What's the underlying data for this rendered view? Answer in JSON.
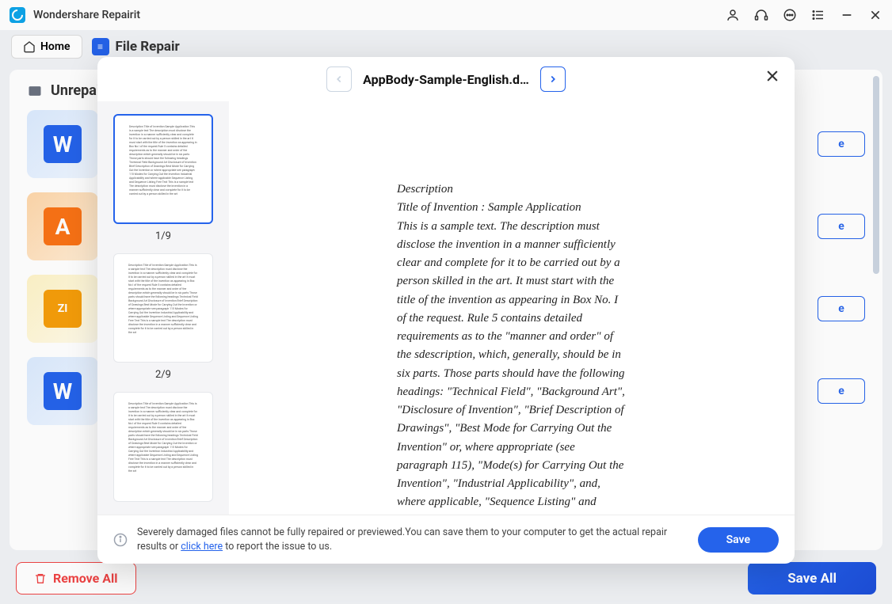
{
  "app": {
    "name": "Wondershare Repairit"
  },
  "nav": {
    "home": "Home",
    "file_repair": "File Repair"
  },
  "section": {
    "title": "Unrepai"
  },
  "tiles": [
    {
      "letter": "W",
      "cls": "tile-w",
      "btn": "e"
    },
    {
      "letter": "A",
      "cls": "tile-a",
      "btn": "e"
    },
    {
      "letter": "ZI",
      "cls": "tile-z",
      "btn": "e"
    },
    {
      "letter": "W",
      "cls": "tile-w",
      "btn": "e"
    }
  ],
  "actions": {
    "remove_all": "Remove All",
    "save_all": "Save All"
  },
  "modal": {
    "filename": "AppBody-Sample-English.d…",
    "thumbs": [
      {
        "label": "1/9",
        "active": true
      },
      {
        "label": "2/9",
        "active": false
      },
      {
        "label": "",
        "active": false
      }
    ],
    "document_text": "Description\nTitle of Invention : Sample Application\nThis is a sample text. The description must disclose the invention in a manner sufficiently clear and complete for it to be carried out by a person skilled in the art. It must start with the title of the invention as appearing in Box No. I of the request. Rule 5 contains detailed requirements as to the \"manner and order\" of the sdescription, which, generally, should be in six parts. Those parts should have the following headings: \"Technical Field\", \"Background Art\", \"Disclosure of Invention\", \"Brief Description of Drawings\", \"Best Mode for Carrying Out the Invention\" or, where appropriate (see paragraph 115), \"Mode(s) for Carrying Out the Invention\", \"Industrial Applicability\", and, where applicable, \"Sequence Listing\" and \"Sequence Listing Free Text\"\nThis is a sample text. The description must disclose the invention in a manner sufficiently clear and complete for it to be carried out by a person skilled in the art. It must start with the",
    "footer_message": "Severely damaged files cannot be fully repaired or previewed.You can save them to your computer to get the actual repair results or ",
    "footer_link": "click here",
    "footer_message_2": " to report the issue to us.",
    "save": "Save"
  },
  "thumb_filler": "Description Title of Invention Sample Application This is a sample text The description must disclose the invention in a manner sufficiently clear and complete for it to be carried out by a person skilled in the art It must start with the title of the invention as appearing in Box No I of the request Rule 5 contains detailed requirements as to the manner and order of the description which generally should be in six parts Those parts should have the following headings Technical Field Background Art Disclosure of Invention Brief Description of Drawings Best Mode for Carrying Out the Invention or where appropriate see paragraph 115 Modes for Carrying Out the Invention Industrial Applicability and where applicable Sequence Listing and Sequence Listing Free Text This is a sample text The description must disclose the invention in a manner sufficiently clear and complete for it to be carried out by a person skilled in the art"
}
